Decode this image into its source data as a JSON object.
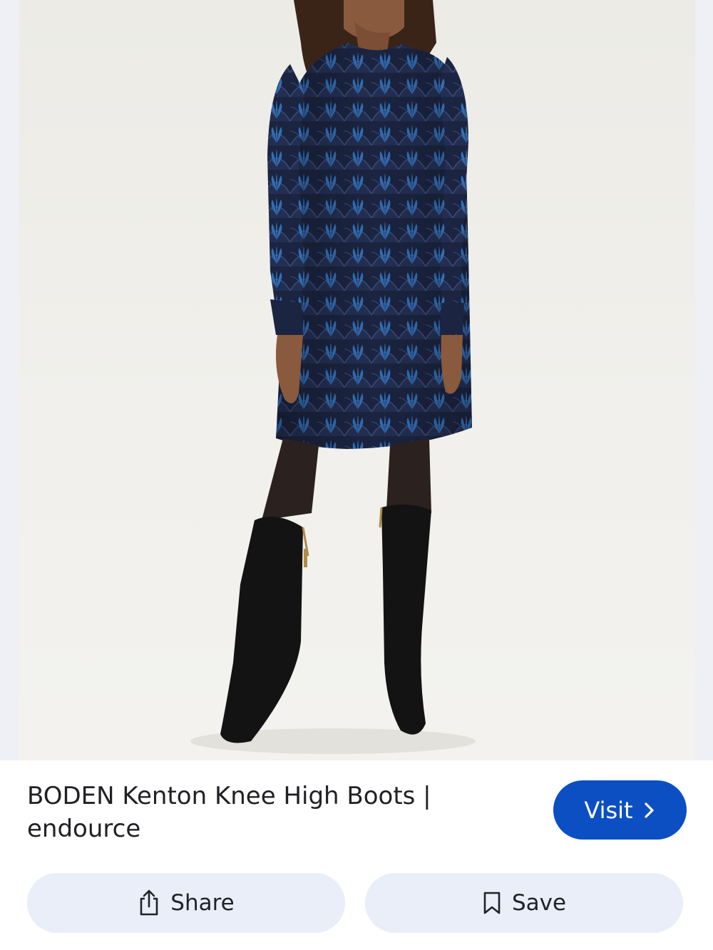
{
  "result": {
    "title_line1": "BODEN Kenton Knee High Boots |",
    "title_line2": "endource",
    "visit_label": "Visit"
  },
  "actions": {
    "share_label": "Share",
    "save_label": "Save"
  },
  "icons": {
    "visit": "chevron-right-icon",
    "share": "share-icon",
    "save": "bookmark-icon"
  },
  "colors": {
    "visit_button": "#0b4fc3",
    "action_button": "#e9eef8",
    "dress_base": "#1d2a4a",
    "dress_accent": "#2f6fb8"
  }
}
